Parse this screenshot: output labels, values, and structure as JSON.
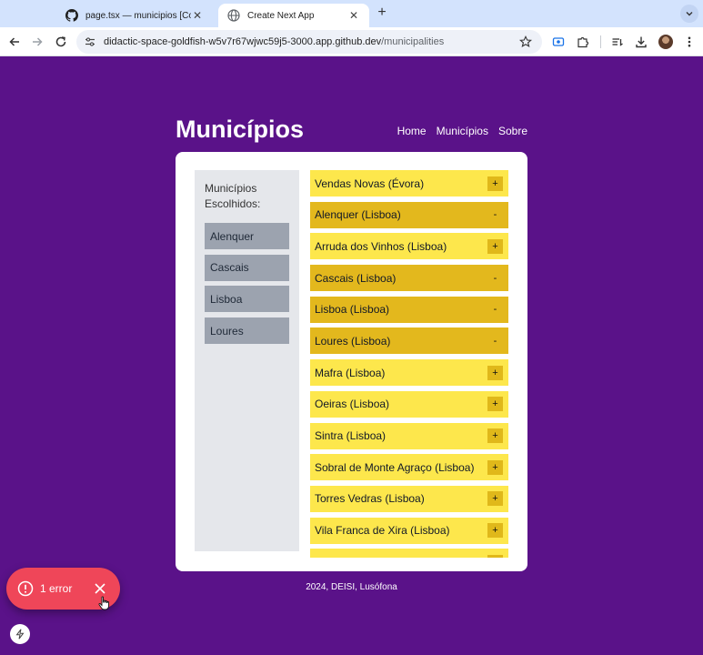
{
  "browser": {
    "tabs": [
      {
        "title": "page.tsx — municipios [Code",
        "active": false,
        "icon": "github-icon"
      },
      {
        "title": "Create Next App",
        "active": true,
        "icon": "globe-icon"
      }
    ],
    "url_host": "didactic-space-goldfish-w5v7r67wjwc59j5-3000.app.github.dev",
    "url_path": "/municipalities"
  },
  "header": {
    "title": "Municípios",
    "nav": [
      {
        "label": "Home"
      },
      {
        "label": "Municípios"
      },
      {
        "label": "Sobre"
      }
    ]
  },
  "chosen": {
    "heading": "Municípios Escolhidos:",
    "items": [
      {
        "label": "Alenquer"
      },
      {
        "label": "Cascais"
      },
      {
        "label": "Lisboa"
      },
      {
        "label": "Loures"
      }
    ]
  },
  "municipalities": [
    {
      "label": "Vendas Novas (Évora)",
      "action": "+",
      "selected": false
    },
    {
      "label": "Alenquer (Lisboa)",
      "action": "-",
      "selected": true
    },
    {
      "label": "Arruda dos Vinhos (Lisboa)",
      "action": "+",
      "selected": false
    },
    {
      "label": "Cascais (Lisboa)",
      "action": "-",
      "selected": true
    },
    {
      "label": "Lisboa (Lisboa)",
      "action": "-",
      "selected": true
    },
    {
      "label": "Loures (Lisboa)",
      "action": "-",
      "selected": true
    },
    {
      "label": "Mafra (Lisboa)",
      "action": "+",
      "selected": false
    },
    {
      "label": "Oeiras (Lisboa)",
      "action": "+",
      "selected": false
    },
    {
      "label": "Sintra (Lisboa)",
      "action": "+",
      "selected": false
    },
    {
      "label": "Sobral de Monte Agraço (Lisboa)",
      "action": "+",
      "selected": false
    },
    {
      "label": "Torres Vedras (Lisboa)",
      "action": "+",
      "selected": false
    },
    {
      "label": "Vila Franca de Xira (Lisboa)",
      "action": "+",
      "selected": false
    },
    {
      "label": "",
      "action": "+",
      "selected": false
    }
  ],
  "footer": {
    "text": "2024, DEISI, Lusófona"
  },
  "dev_overlay": {
    "error_label": "1 error"
  },
  "colors": {
    "page_background": "#5a1289",
    "item_unselected": "#fde74c",
    "item_selected": "#e3b81d",
    "chosen_item": "#9ca3af",
    "error_toast": "#ef4659"
  }
}
